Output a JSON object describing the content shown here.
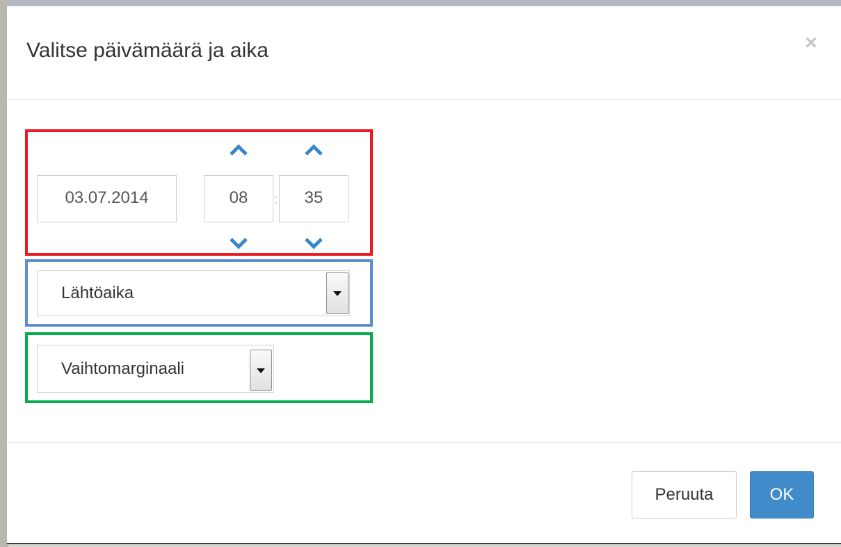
{
  "dialog": {
    "title": "Valitse päivämäärä ja aika",
    "close_glyph": "×"
  },
  "datetime": {
    "date": "03.07.2014",
    "hour": "08",
    "minute": "35",
    "separator": ":"
  },
  "selects": {
    "time_type": "Lähtöaika",
    "transfer_margin": "Vaihtomarginaali"
  },
  "footer": {
    "cancel_label": "Peruuta",
    "ok_label": "OK"
  },
  "icons": {
    "close": "close-icon",
    "up": "chevron-up-icon",
    "down": "chevron-down-icon",
    "select_arrow": "caret-down-icon"
  },
  "colors": {
    "primary": "#428bca",
    "chevron": "#3a87c8",
    "frame_red": "#ed1c24",
    "frame_blue": "#5b8fd3",
    "frame_green": "#0aab4e"
  }
}
